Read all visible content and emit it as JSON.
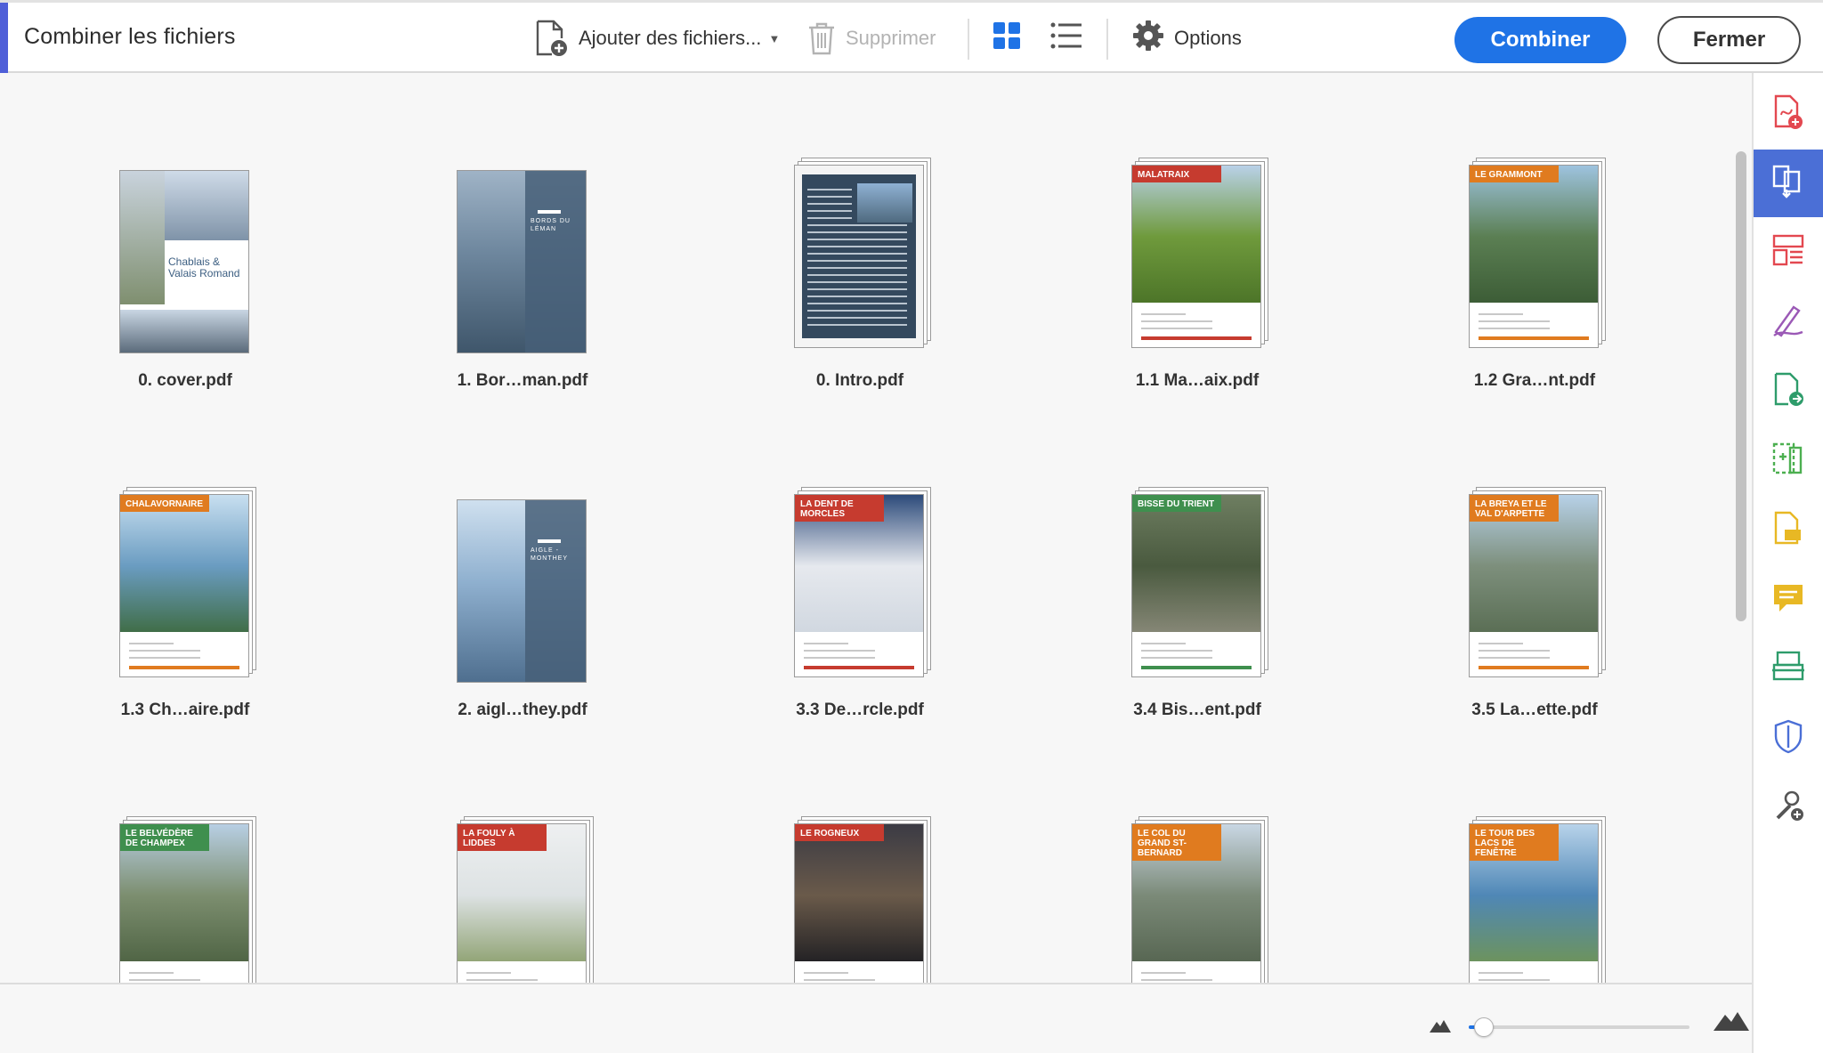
{
  "toolbar": {
    "title": "Combiner les fichiers",
    "add_files_label": "Ajouter des fichiers...",
    "delete_label": "Supprimer",
    "options_label": "Options",
    "combine_label": "Combiner",
    "close_label": "Fermer",
    "accent_color": "#4f5fd8",
    "primary_color": "#1f73e6"
  },
  "files": [
    {
      "name": "0. cover.pdf",
      "stack": false,
      "banner": "Chablais & Valais Romand",
      "style": "cover"
    },
    {
      "name": "1. Bor…man.pdf",
      "stack": false,
      "banner": "BORDS DU LÉMAN",
      "style": "section"
    },
    {
      "name": "0. Intro.pdf",
      "stack": true,
      "banner": "",
      "style": "intro"
    },
    {
      "name": "1.1 Ma…aix.pdf",
      "stack": true,
      "banner": "MALATRAIX",
      "color": "#c63b2f",
      "style": "grass"
    },
    {
      "name": "1.2 Gra…nt.pdf",
      "stack": true,
      "banner": "LE GRAMMONT",
      "color": "#e07b1f",
      "style": "cliff"
    },
    {
      "name": "1.3 Ch…aire.pdf",
      "stack": true,
      "banner": "CHALAVORNAIRE",
      "color": "#e07b1f",
      "style": "lake"
    },
    {
      "name": "2. aigl…they.pdf",
      "stack": false,
      "banner": "AIGLE - MONTHEY",
      "style": "section2"
    },
    {
      "name": "3.3 De…rcle.pdf",
      "stack": true,
      "banner": "LA DENT DE MORCLES",
      "color": "#c63b2f",
      "style": "clouds"
    },
    {
      "name": "3.4 Bis…ent.pdf",
      "stack": true,
      "banner": "BISSE DU TRIENT",
      "color": "#3f8f4e",
      "style": "forest"
    },
    {
      "name": "3.5 La…ette.pdf",
      "stack": true,
      "banner": "LA BREYA ET LE VAL D'ARPETTE",
      "color": "#e07b1f",
      "style": "valley"
    },
    {
      "name": "",
      "stack": true,
      "banner": "LE BELVÉDÈRE DE CHAMPEX",
      "color": "#3f8f4e",
      "style": "valley2"
    },
    {
      "name": "",
      "stack": true,
      "banner": "LA FOULY À LIDDES",
      "color": "#c63b2f",
      "style": "mist"
    },
    {
      "name": "",
      "stack": true,
      "banner": "LE ROGNEUX",
      "color": "#c63b2f",
      "style": "night"
    },
    {
      "name": "",
      "stack": true,
      "banner": "LE COL DU GRAND ST-BERNARD",
      "color": "#e07b1f",
      "style": "pass"
    },
    {
      "name": "",
      "stack": true,
      "banner": "LE TOUR DES LACS DE FENÊTRE",
      "color": "#e07b1f",
      "style": "alplake"
    }
  ],
  "right_panel": {
    "tools": [
      {
        "icon": "create-pdf-icon",
        "color": "#e34850",
        "active": false
      },
      {
        "icon": "combine-files-icon",
        "color": "#ffffff",
        "active": true
      },
      {
        "icon": "organize-pages-icon",
        "color": "#e34850",
        "active": false
      },
      {
        "icon": "fill-sign-icon",
        "color": "#9b59b6",
        "active": false
      },
      {
        "icon": "export-pdf-icon",
        "color": "#2e9c6b",
        "active": false
      },
      {
        "icon": "edit-pdf-icon",
        "color": "#4caf50",
        "active": false
      },
      {
        "icon": "send-for-comments-icon",
        "color": "#e8b824",
        "active": false
      },
      {
        "icon": "comment-icon",
        "color": "#e8b824",
        "active": false
      },
      {
        "icon": "scan-icon",
        "color": "#2e9c6b",
        "active": false
      },
      {
        "icon": "protect-icon",
        "color": "#4b6fd6",
        "active": false
      },
      {
        "icon": "more-tools-icon",
        "color": "#555555",
        "active": false
      }
    ]
  },
  "zoom": {
    "value": 0.05
  }
}
